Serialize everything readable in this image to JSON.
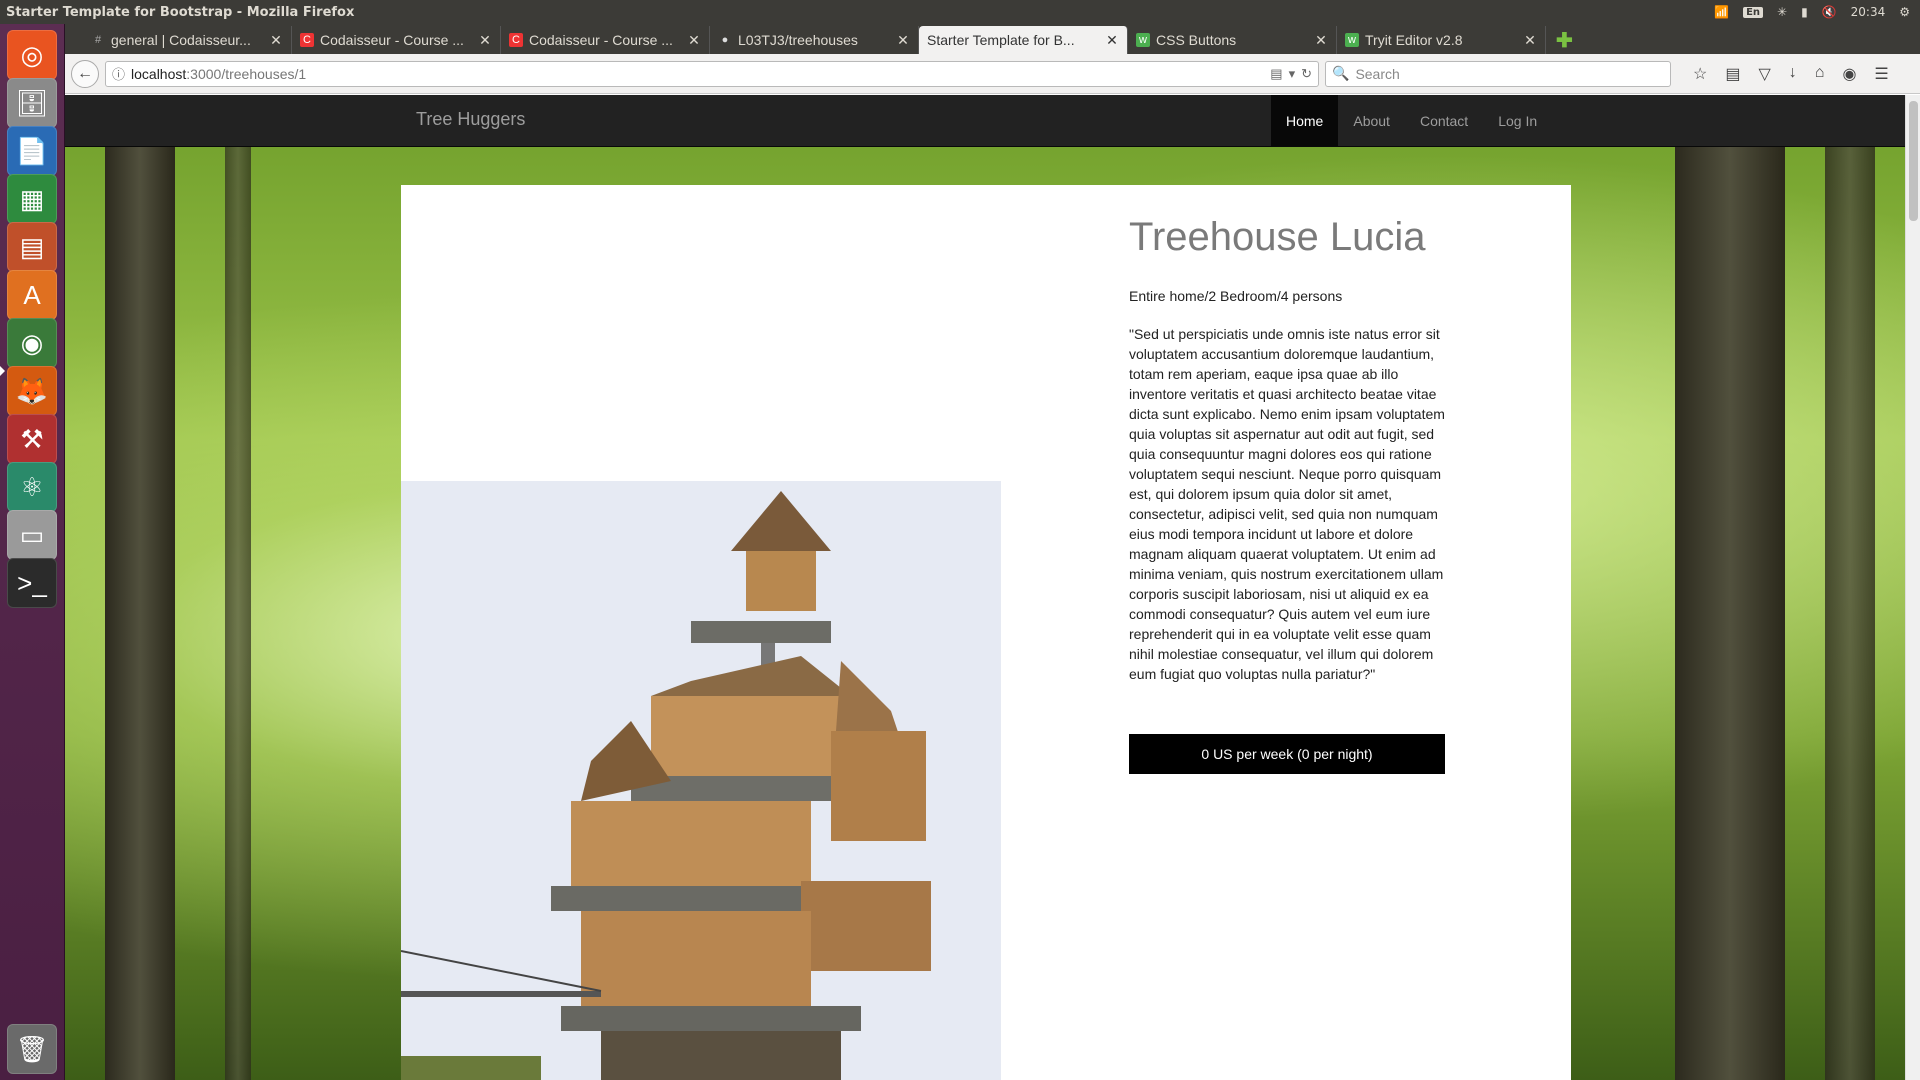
{
  "system": {
    "window_title": "Starter Template for Bootstrap - Mozilla Firefox",
    "keyboard_layout": "En",
    "clock": "20:34"
  },
  "launcher": {
    "items": [
      "dash-home",
      "files",
      "writer",
      "calc",
      "impress",
      "software-center",
      "chrome",
      "firefox",
      "system-settings",
      "atom",
      "disk",
      "terminal",
      "trash"
    ]
  },
  "browser": {
    "tabs": [
      {
        "label": "general | Codaisseur...",
        "favicon": "#"
      },
      {
        "label": "Codaisseur - Course ...",
        "favicon": "C"
      },
      {
        "label": "Codaisseur - Course ...",
        "favicon": "C"
      },
      {
        "label": "L03TJ3/treehouses",
        "favicon": "gh"
      },
      {
        "label": "Starter Template for B...",
        "favicon": ""
      },
      {
        "label": "CSS Buttons",
        "favicon": "w3"
      },
      {
        "label": "Tryit Editor v2.8",
        "favicon": "w3"
      }
    ],
    "url_host": "localhost",
    "url_path": ":3000/treehouses/1",
    "search_placeholder": "Search"
  },
  "site": {
    "brand": "Tree Huggers",
    "nav": [
      "Home",
      "About",
      "Contact",
      "Log In"
    ],
    "title": "Treehouse Lucia",
    "subtitle": "Entire home/2 Bedroom/4 persons",
    "description": "\"Sed ut perspiciatis unde omnis iste natus error sit voluptatem accusantium doloremque laudantium, totam rem aperiam, eaque ipsa quae ab illo inventore veritatis et quasi architecto beatae vitae dicta sunt explicabo. Nemo enim ipsam voluptatem quia voluptas sit aspernatur aut odit aut fugit, sed quia consequuntur magni dolores eos qui ratione voluptatem sequi nesciunt. Neque porro quisquam est, qui dolorem ipsum quia dolor sit amet, consectetur, adipisci velit, sed quia non numquam eius modi tempora incidunt ut labore et dolore magnam aliquam quaerat voluptatem. Ut enim ad minima veniam, quis nostrum exercitationem ullam corporis suscipit laboriosam, nisi ut aliquid ex ea commodi consequatur? Quis autem vel eum iure reprehenderit qui in ea voluptate velit esse quam nihil molestiae consequatur, vel illum qui dolorem eum fugiat quo voluptas nulla pariatur?\"",
    "price_label": "0 US per week (0 per night)"
  },
  "colors": {
    "navbar_bg": "#222222",
    "nav_active_bg": "#080808",
    "price_button_bg": "#000000",
    "launcher_bg": "#5c2d52"
  }
}
